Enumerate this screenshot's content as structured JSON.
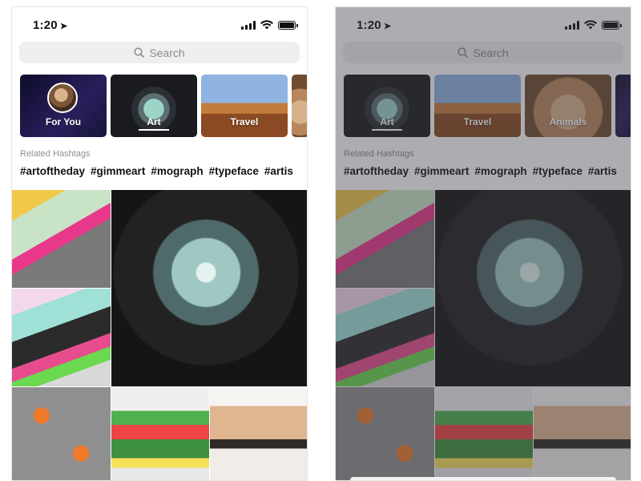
{
  "status_bar": {
    "time": "1:20",
    "location_glyph": "➤"
  },
  "search": {
    "placeholder": "Search",
    "icon": "search-icon"
  },
  "categories_left": [
    {
      "label": "For You",
      "image": "profile-avatar"
    },
    {
      "label": "Art",
      "selected": true,
      "image": "paint-splatter"
    },
    {
      "label": "Travel",
      "image": "sand-dune"
    },
    {
      "label": "",
      "image": "dog"
    }
  ],
  "categories_right": [
    {
      "label": "Art",
      "selected": true,
      "image": "paint-splatter"
    },
    {
      "label": "Travel",
      "image": "sand-dune"
    },
    {
      "label": "Animals",
      "image": "dog"
    },
    {
      "label": "",
      "image": "next"
    }
  ],
  "related": {
    "title": "Related Hashtags"
  },
  "hashtags": [
    "#artoftheday",
    "#gimmeart",
    "#mograph",
    "#typeface",
    "#artis"
  ],
  "grid": {
    "tiles": [
      {
        "image": "abstract-painting-desk"
      },
      {
        "image": "paint-splatter-vortex"
      },
      {
        "image": "neon-figure-illustration"
      },
      {
        "image": "koi-fish-drawing"
      },
      {
        "image": "lego-robot"
      },
      {
        "image": "watercolor-portrait"
      }
    ]
  },
  "colors": {
    "overlay": "#3c3c46",
    "text_secondary": "#8e8e8e",
    "search_bg": "#efefef"
  }
}
